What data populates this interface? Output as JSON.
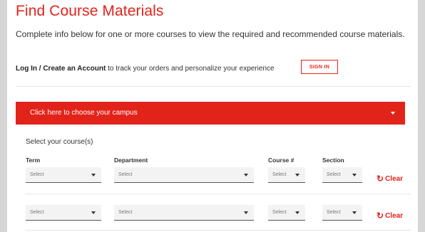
{
  "page": {
    "title": "Find Course Materials",
    "intro": "Complete info below for one or more courses to view the required and recommended course materials.",
    "login_bold": "Log In / Create an Account",
    "login_rest": " to track your orders and personalize your experience",
    "signin_label": "SIGN IN"
  },
  "campus": {
    "label": "Click here to choose your campus"
  },
  "courses": {
    "heading": "Select your course(s)",
    "columns": {
      "term": "Term",
      "department": "Department",
      "course": "Course #",
      "section": "Section"
    },
    "rows": [
      {
        "term": "Select",
        "department": "Select",
        "course": "Select",
        "section": "Select",
        "clear": "Clear"
      },
      {
        "term": "Select",
        "department": "Select",
        "course": "Select",
        "section": "Select",
        "clear": "Clear"
      }
    ]
  },
  "colors": {
    "accent": "#e2231a",
    "background": "#d6d6d6",
    "panel": "#ffffff"
  },
  "icons": {
    "clear": "refresh-icon",
    "dropdown": "caret-down-icon"
  }
}
